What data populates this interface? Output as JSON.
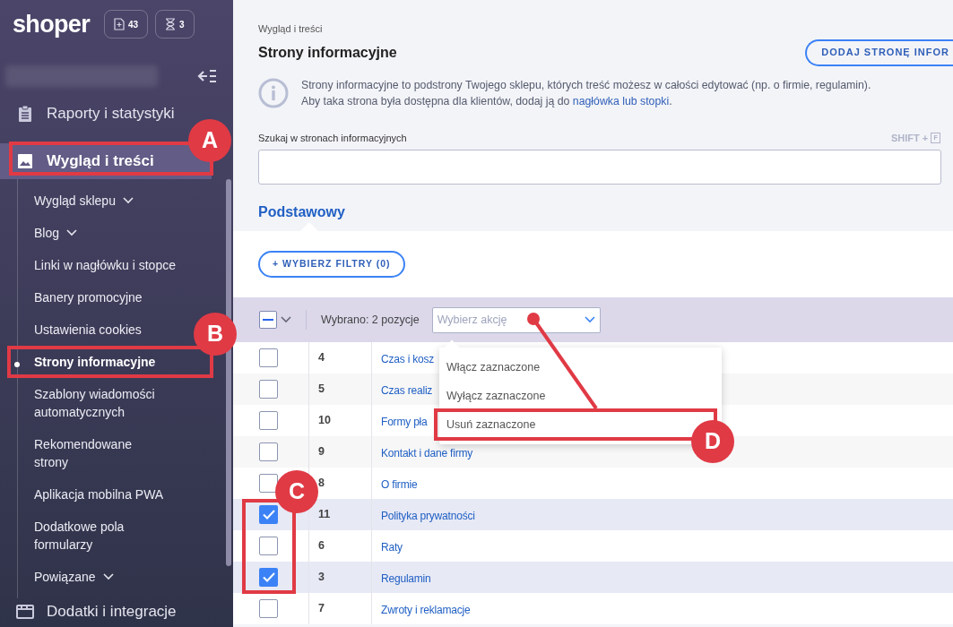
{
  "header": {
    "logo": "shoper",
    "badges": [
      {
        "kind": "new-doc",
        "count": "43"
      },
      {
        "kind": "hourglass",
        "count": "3"
      }
    ]
  },
  "sidebar": {
    "items": [
      {
        "label": "Raporty i statystyki",
        "kind": "clipboard",
        "selected": false
      },
      {
        "label": "Wygląd i treści",
        "kind": "image",
        "selected": true,
        "children": [
          {
            "label": "Wygląd sklepu",
            "submenu": true,
            "selected": false
          },
          {
            "label": "Blog",
            "submenu": true,
            "selected": false
          },
          {
            "label": "Linki w nagłówku i stopce",
            "submenu": false,
            "selected": false
          },
          {
            "label": "Banery promocyjne",
            "submenu": false,
            "selected": false
          },
          {
            "label": "Ustawienia cookies",
            "submenu": false,
            "selected": false
          },
          {
            "label": "Strony informacyjne",
            "submenu": false,
            "selected": true
          },
          {
            "label": "Szablony wiadomości automatycznych",
            "submenu": false,
            "selected": false
          },
          {
            "label": "Rekomendowane strony",
            "submenu": false,
            "selected": false
          },
          {
            "label": "Aplikacja mobilna PWA",
            "submenu": false,
            "selected": false
          },
          {
            "label": "Dodatkowe pola formularzy",
            "submenu": false,
            "selected": false
          },
          {
            "label": "Powiązane",
            "submenu": true,
            "selected": false
          }
        ]
      },
      {
        "label": "Dodatki i integracje",
        "kind": "window",
        "selected": false
      }
    ]
  },
  "main": {
    "breadcrumb": "Wygląd i treści",
    "title": "Strony informacyjne",
    "add_button": "DODAJ STRONĘ INFOR",
    "info": {
      "line1": "Strony informacyjne to podstrony Twojego sklepu, których treść możesz w całości edytować (np. o firmie, regulamin).",
      "line2": "Aby taka strona była dostępna dla klientów, dodaj ją do ",
      "link": "nagłówka lub stopki",
      "end": "."
    },
    "search": {
      "label": "Szukaj w stronach informacyjnych",
      "shortcut": "SHIFT +",
      "key": "F"
    },
    "tabs": [
      {
        "label": "Podstawowy",
        "selected": true
      }
    ],
    "filter_button": "+ WYBIERZ FILTRY (0)",
    "bulk": {
      "indeterminate": true,
      "selected_text": "Wybrano: 2 pozycje",
      "action_placeholder": "Wybierz akcję"
    },
    "action_menu": [
      "Włącz zaznaczone",
      "Wyłącz zaznaczone",
      "Usuń zaznaczone"
    ],
    "rows": [
      {
        "id": "4",
        "name": "Czas i kosz",
        "checked": false
      },
      {
        "id": "5",
        "name": "Czas realiz",
        "checked": false
      },
      {
        "id": "10",
        "name": "Formy pła",
        "checked": false
      },
      {
        "id": "9",
        "name": "Kontakt i dane firmy",
        "checked": false
      },
      {
        "id": "8",
        "name": "O firmie",
        "checked": false
      },
      {
        "id": "11",
        "name": "Polityka prywatności",
        "checked": true
      },
      {
        "id": "6",
        "name": "Raty",
        "checked": false
      },
      {
        "id": "3",
        "name": "Regulamin",
        "checked": true
      },
      {
        "id": "7",
        "name": "Zwroty i reklamacje",
        "checked": false
      }
    ]
  },
  "annotations": [
    {
      "label": "A"
    },
    {
      "label": "B"
    },
    {
      "label": "C"
    },
    {
      "label": "D"
    }
  ]
}
